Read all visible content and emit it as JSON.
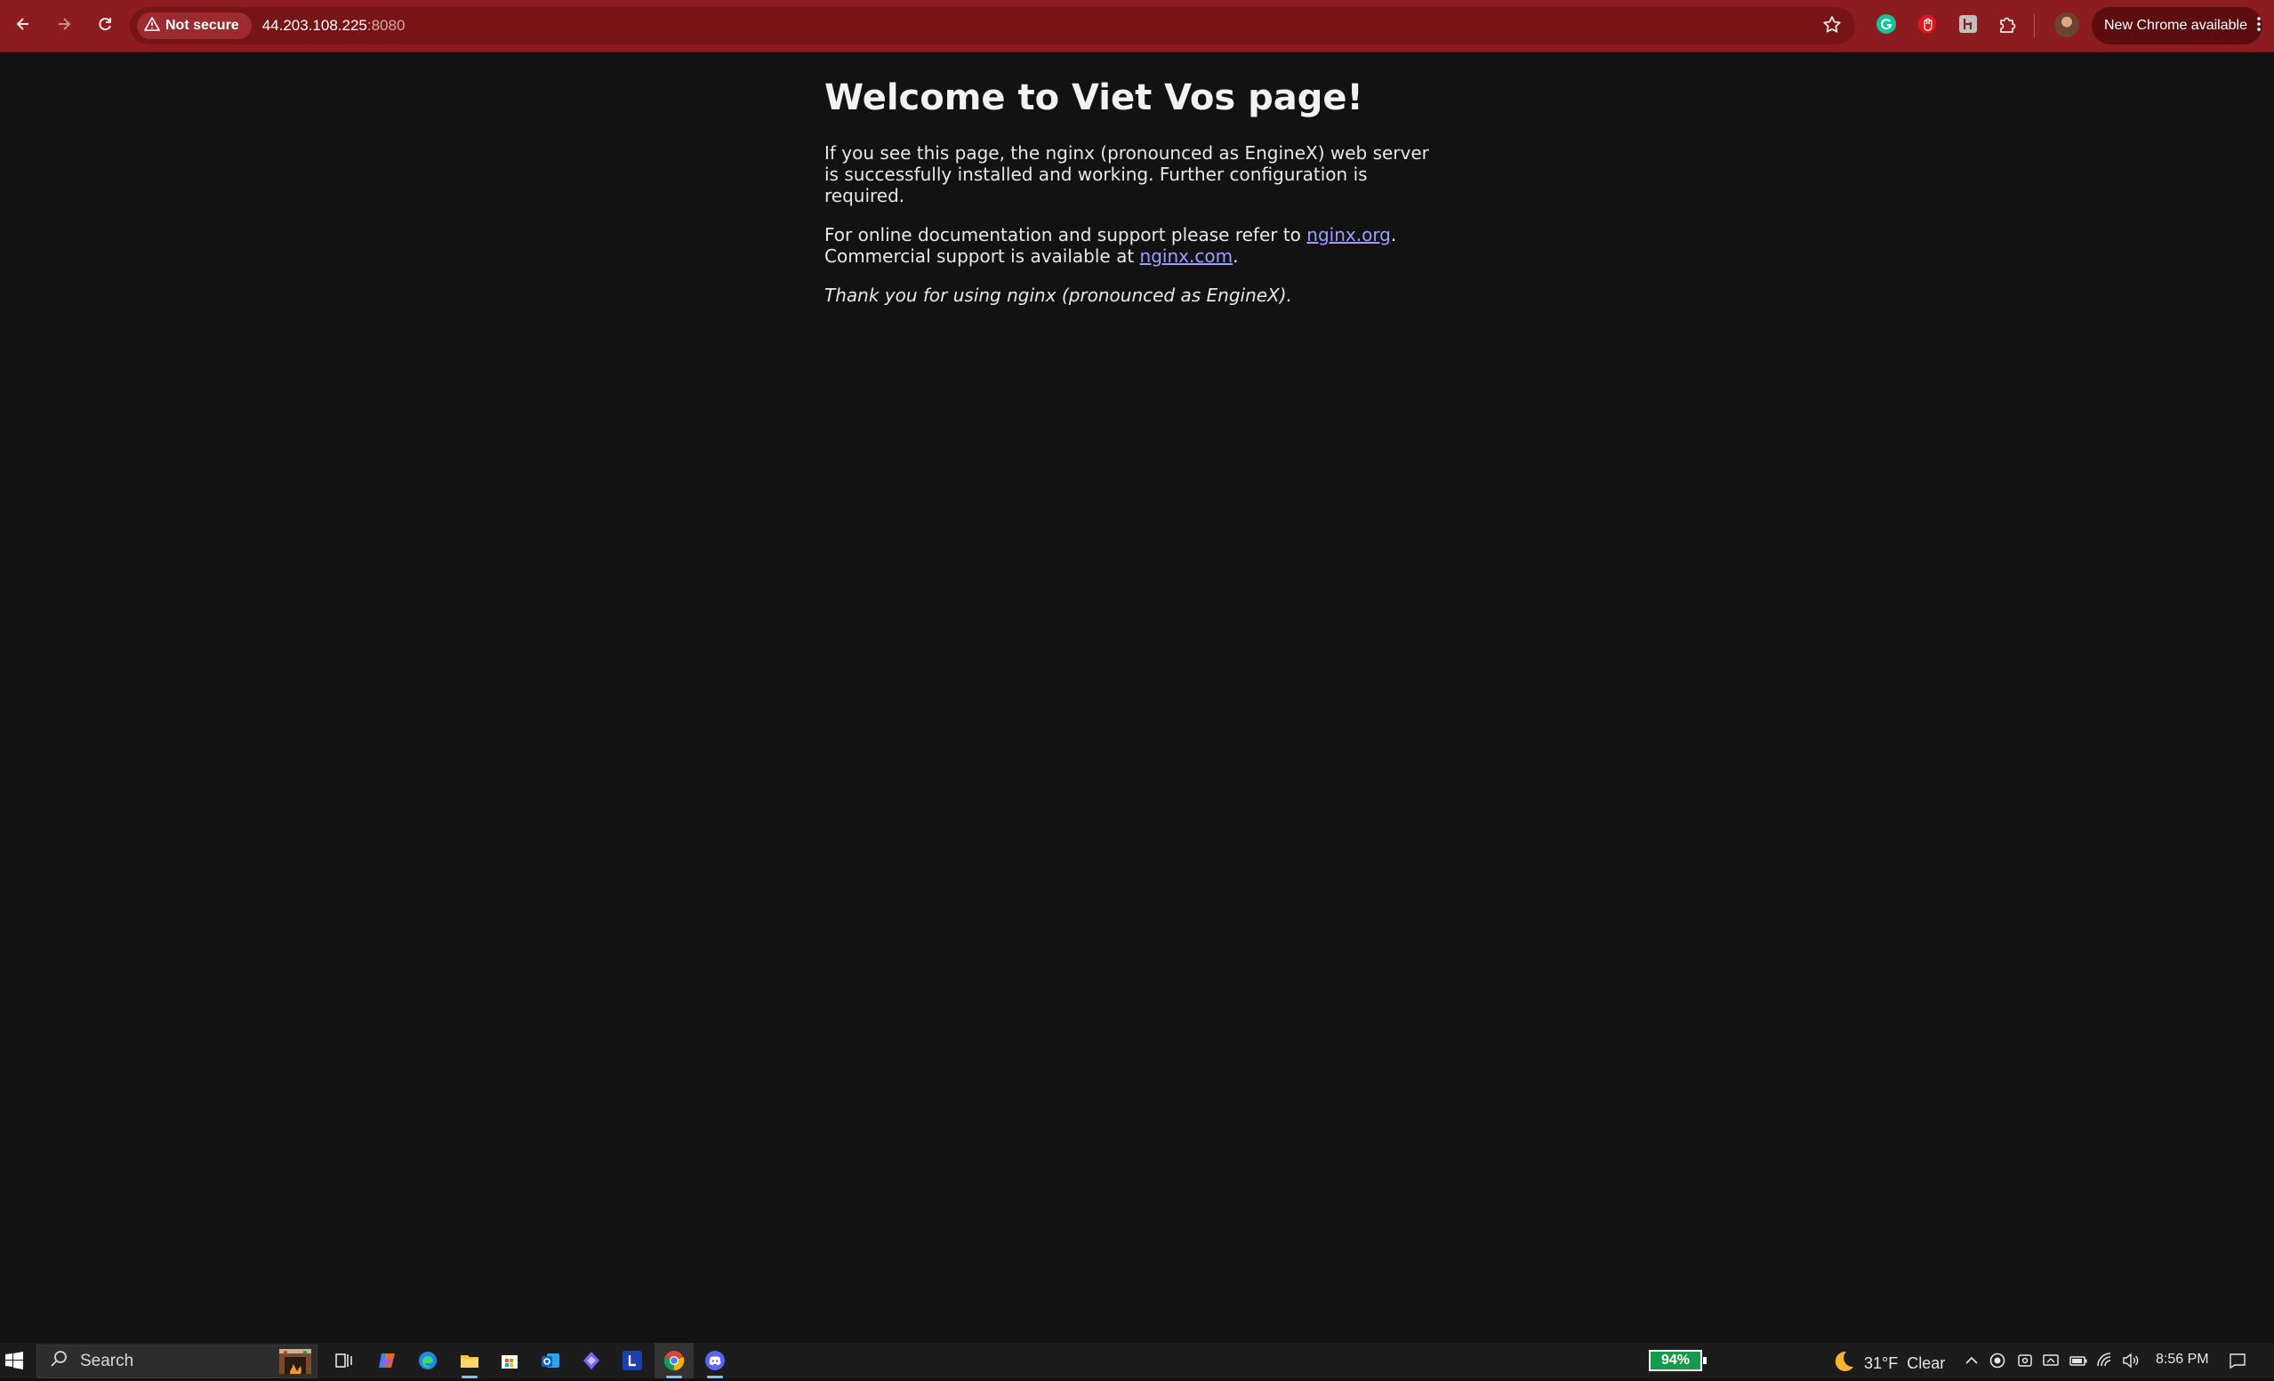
{
  "browser": {
    "security_chip": "Not secure",
    "url_host": "44.203.108.225",
    "url_port": ":8080",
    "update_pill": "New Chrome available",
    "accent_color": "#8c1c1f"
  },
  "icons": {
    "back": "back-arrow-icon",
    "forward": "forward-arrow-icon",
    "reload": "reload-icon",
    "warning": "warning-triangle-icon",
    "bookmark": "star-icon",
    "extensions": [
      "grammarly-icon",
      "adblock-icon",
      "extension-h-icon",
      "puzzle-icon"
    ],
    "menu": "kebab-menu-icon"
  },
  "page": {
    "heading": "Welcome to Viet Vos page!",
    "para1": "If you see this page, the nginx (pronounced as EngineX) web server is successfully installed and working. Further configuration is required.",
    "para2_prefix": "For online documentation and support please refer to ",
    "link1": "nginx.org",
    "para2_mid": ".",
    "para2_line2": "Commercial support is available at ",
    "link2": "nginx.com",
    "para2_end": ".",
    "thanks": "Thank you for using nginx (pronounced as EngineX).",
    "link_color": "#9e9eff"
  },
  "taskbar": {
    "search_label": "Search",
    "battery_percent": "94%",
    "weather_temp": "31°F",
    "weather_text": "Clear",
    "time": "8:56 PM",
    "apps": [
      "task-view",
      "copilot",
      "edge",
      "file-explorer",
      "microsoft-store",
      "outlook",
      "app-purple",
      "app-L",
      "chrome",
      "discord"
    ]
  }
}
